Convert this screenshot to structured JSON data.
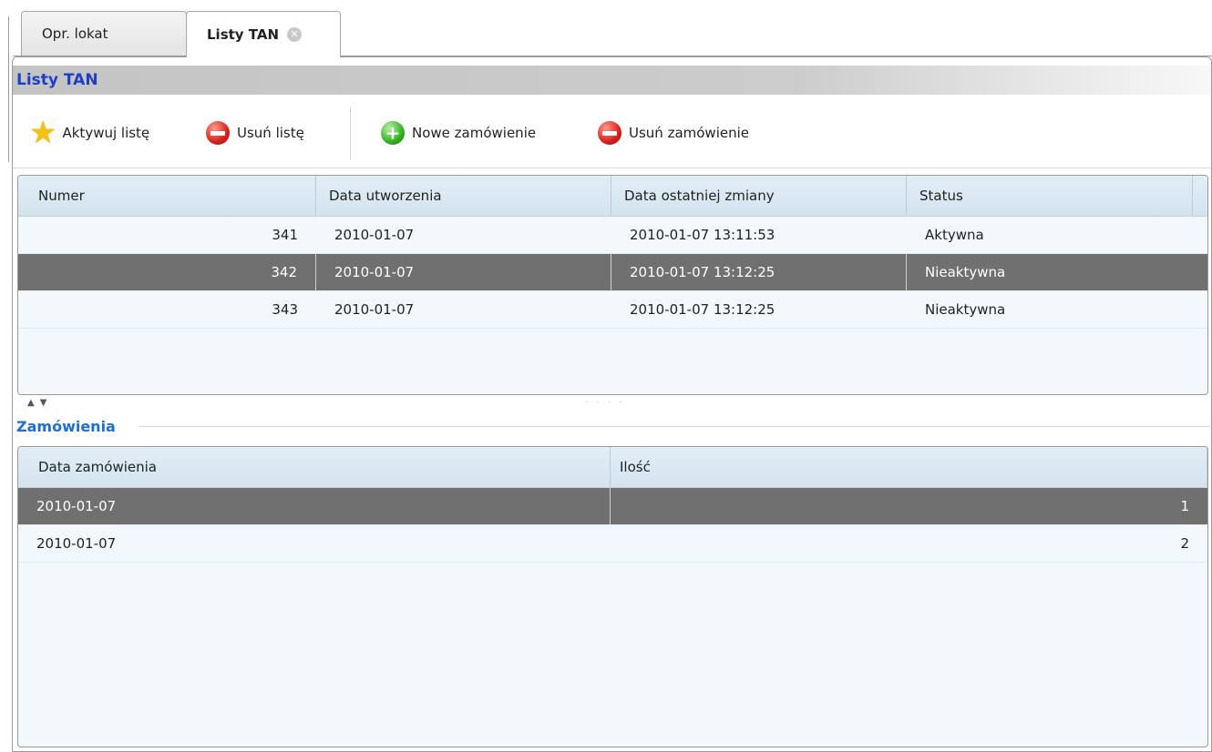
{
  "tabs": [
    {
      "label": "Opr. lokat"
    },
    {
      "label": "Listy TAN"
    }
  ],
  "panel": {
    "title": "Listy TAN"
  },
  "toolbar": {
    "activate": "Aktywuj listę",
    "delete_list": "Usuń listę",
    "new_order": "Nowe zamówienie",
    "delete_order": "Usuń zamówienie"
  },
  "lists_table": {
    "columns": [
      "Numer",
      "Data utworzenia",
      "Data ostatniej zmiany",
      "Status"
    ],
    "rows": [
      {
        "numer": "341",
        "created": "2010-01-07",
        "changed": "2010-01-07 13:11:53",
        "status": "Aktywna"
      },
      {
        "numer": "342",
        "created": "2010-01-07",
        "changed": "2010-01-07 13:12:25",
        "status": "Nieaktywna"
      },
      {
        "numer": "343",
        "created": "2010-01-07",
        "changed": "2010-01-07 13:12:25",
        "status": "Nieaktywna"
      }
    ]
  },
  "orders": {
    "title": "Zamówienia",
    "columns": [
      "Data zamówienia",
      "Ilość"
    ],
    "rows": [
      {
        "date": "2010-01-07",
        "qty": "1"
      },
      {
        "date": "2010-01-07",
        "qty": "2"
      }
    ]
  },
  "icons": {
    "tab_close": "close-circle-icon",
    "activate": "star-icon",
    "delete": "minus-circle-icon",
    "add": "plus-circle-icon",
    "splitter": "collapse-expand-arrows-icon"
  },
  "colors": {
    "title_text": "#1f3ec8",
    "section_text": "#1a6fd1",
    "selected_row": "#707070",
    "grid_bg": "#f2f8fc",
    "grid_header": "#d3e3ee"
  }
}
